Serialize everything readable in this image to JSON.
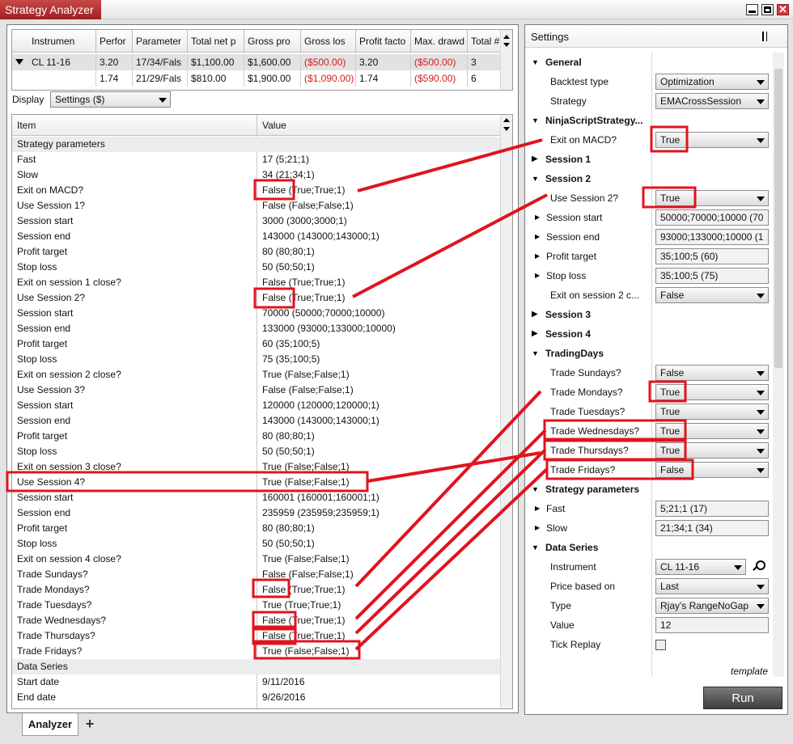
{
  "window": {
    "title": "Strategy Analyzer"
  },
  "results": {
    "columns": [
      "Instrumen",
      "Perfor",
      "Parameter",
      "Total net p",
      "Gross pro",
      "Gross los",
      "Profit facto",
      "Max. drawd",
      "Total # of t"
    ],
    "rows": [
      {
        "instrument": "CL 11-16",
        "perf": "3.20",
        "params": "17/34/Fals",
        "net": "$1,100.00",
        "gross_profit": "$1,600.00",
        "gross_loss": "($500.00)",
        "profit_factor": "3.20",
        "max_dd": "($500.00)",
        "trades": "3"
      },
      {
        "instrument": "",
        "perf": "1.74",
        "params": "21/29/Fals",
        "net": "$810.00",
        "gross_profit": "$1,900.00",
        "gross_loss": "($1,090.00)",
        "profit_factor": "1.74",
        "max_dd": "($590.00)",
        "trades": "6"
      }
    ]
  },
  "display": {
    "label": "Display",
    "value": "Settings ($)"
  },
  "properties": {
    "col_item": "Item",
    "col_value": "Value",
    "rows": [
      {
        "item": "Strategy parameters",
        "value": "",
        "cat": true
      },
      {
        "item": "Fast",
        "value": "17 (5;21;1)"
      },
      {
        "item": "Slow",
        "value": "34 (21;34;1)"
      },
      {
        "item": "Exit on MACD?",
        "value": "False (True;True;1)"
      },
      {
        "item": "Use Session 1?",
        "value": "False (False;False;1)"
      },
      {
        "item": "Session start",
        "value": "3000 (3000;3000;1)"
      },
      {
        "item": "Session end",
        "value": "143000 (143000;143000;1)"
      },
      {
        "item": "Profit target",
        "value": "80 (80;80;1)"
      },
      {
        "item": "Stop loss",
        "value": "50 (50;50;1)"
      },
      {
        "item": "Exit on session 1 close?",
        "value": "False (True;True;1)"
      },
      {
        "item": "Use Session 2?",
        "value": "False (True;True;1)"
      },
      {
        "item": "Session start",
        "value": "70000 (50000;70000;10000)"
      },
      {
        "item": "Session end",
        "value": "133000 (93000;133000;10000)"
      },
      {
        "item": "Profit target",
        "value": "60 (35;100;5)"
      },
      {
        "item": "Stop loss",
        "value": "75 (35;100;5)"
      },
      {
        "item": "Exit on session 2 close?",
        "value": "True (False;False;1)"
      },
      {
        "item": "Use Session 3?",
        "value": "False (False;False;1)"
      },
      {
        "item": "Session start",
        "value": "120000 (120000;120000;1)"
      },
      {
        "item": "Session end",
        "value": "143000 (143000;143000;1)"
      },
      {
        "item": "Profit target",
        "value": "80 (80;80;1)"
      },
      {
        "item": "Stop loss",
        "value": "50 (50;50;1)"
      },
      {
        "item": "Exit on session 3 close?",
        "value": "True (False;False;1)"
      },
      {
        "item": "Use Session 4?",
        "value": "True (False;False;1)"
      },
      {
        "item": "Session  start",
        "value": "160001 (160001;160001;1)"
      },
      {
        "item": "Session end",
        "value": "235959 (235959;235959;1)"
      },
      {
        "item": "Profit target",
        "value": "80 (80;80;1)"
      },
      {
        "item": "Stop loss",
        "value": "50 (50;50;1)"
      },
      {
        "item": "Exit on session 4 close?",
        "value": "True (False;False;1)"
      },
      {
        "item": "Trade Sundays?",
        "value": "False (False;False;1)"
      },
      {
        "item": "Trade Mondays?",
        "value": "False (True;True;1)"
      },
      {
        "item": "Trade Tuesdays?",
        "value": "True (True;True;1)"
      },
      {
        "item": "Trade Wednesdays?",
        "value": "False (True;True;1)"
      },
      {
        "item": "Trade Thursdays?",
        "value": "False (True;True;1)"
      },
      {
        "item": "Trade Fridays?",
        "value": "True (False;False;1)"
      },
      {
        "item": "Data Series",
        "value": "",
        "cat": true
      },
      {
        "item": "Start date",
        "value": "9/11/2016"
      },
      {
        "item": "End date",
        "value": "9/26/2016"
      }
    ]
  },
  "tabs": {
    "analyzer": "Analyzer",
    "add": "+"
  },
  "settings": {
    "title": "Settings",
    "rows": [
      {
        "type": "cat",
        "label": "General",
        "expanded": true
      },
      {
        "type": "field",
        "label": "Backtest type",
        "value": "Optimization",
        "ctl": "dd"
      },
      {
        "type": "field",
        "label": "Strategy",
        "value": "EMACrossSession",
        "ctl": "dd"
      },
      {
        "type": "cat",
        "label": "NinjaScriptStrategy...",
        "expanded": true
      },
      {
        "type": "field",
        "label": "Exit on MACD?",
        "value": "True",
        "ctl": "dd"
      },
      {
        "type": "cat",
        "label": "Session 1",
        "expanded": false
      },
      {
        "type": "cat",
        "label": "Session 2",
        "expanded": true
      },
      {
        "type": "field",
        "label": "Use Session 2?",
        "value": "True",
        "ctl": "dd"
      },
      {
        "type": "sub",
        "label": "Session start",
        "value": "50000;70000;10000 (70",
        "ctl": "ro"
      },
      {
        "type": "sub",
        "label": "Session end",
        "value": "93000;133000;10000 (1",
        "ctl": "ro"
      },
      {
        "type": "sub",
        "label": "Profit target",
        "value": "35;100;5 (60)",
        "ctl": "ro"
      },
      {
        "type": "sub",
        "label": "Stop loss",
        "value": "35;100;5 (75)",
        "ctl": "ro"
      },
      {
        "type": "field",
        "label": "Exit on session 2 c...",
        "value": "False",
        "ctl": "dd"
      },
      {
        "type": "cat",
        "label": "Session 3",
        "expanded": false
      },
      {
        "type": "cat",
        "label": "Session 4",
        "expanded": false
      },
      {
        "type": "cat",
        "label": "TradingDays",
        "expanded": true
      },
      {
        "type": "field",
        "label": "Trade Sundays?",
        "value": "False",
        "ctl": "dd"
      },
      {
        "type": "field",
        "label": "Trade Mondays?",
        "value": "True",
        "ctl": "dd"
      },
      {
        "type": "field",
        "label": "Trade Tuesdays?",
        "value": "True",
        "ctl": "dd"
      },
      {
        "type": "field",
        "label": "Trade Wednesdays?",
        "value": "True",
        "ctl": "dd"
      },
      {
        "type": "field",
        "label": "Trade Thursdays?",
        "value": "True",
        "ctl": "dd"
      },
      {
        "type": "field",
        "label": "Trade Fridays?",
        "value": "False",
        "ctl": "dd"
      },
      {
        "type": "cat",
        "label": "Strategy parameters",
        "expanded": true
      },
      {
        "type": "sub",
        "label": "Fast",
        "value": "5;21;1 (17)",
        "ctl": "ro"
      },
      {
        "type": "sub",
        "label": "Slow",
        "value": "21;34;1 (34)",
        "ctl": "ro"
      },
      {
        "type": "cat",
        "label": "Data Series",
        "expanded": true
      },
      {
        "type": "field",
        "label": "Instrument",
        "value": "CL 11-16",
        "ctl": "instrument"
      },
      {
        "type": "field",
        "label": "Price based on",
        "value": "Last",
        "ctl": "dd"
      },
      {
        "type": "field",
        "label": "Type",
        "value": "Rjay's RangeNoGap",
        "ctl": "dd"
      },
      {
        "type": "field",
        "label": "Value",
        "value": "12",
        "ctl": "ro"
      },
      {
        "type": "field",
        "label": "Tick Replay",
        "value": "",
        "ctl": "checkbox"
      }
    ],
    "template": "template",
    "run": "Run"
  },
  "colors": {
    "annotation": "#e0141e",
    "negative": "#d71a1a",
    "title_bar": "#b83232"
  }
}
